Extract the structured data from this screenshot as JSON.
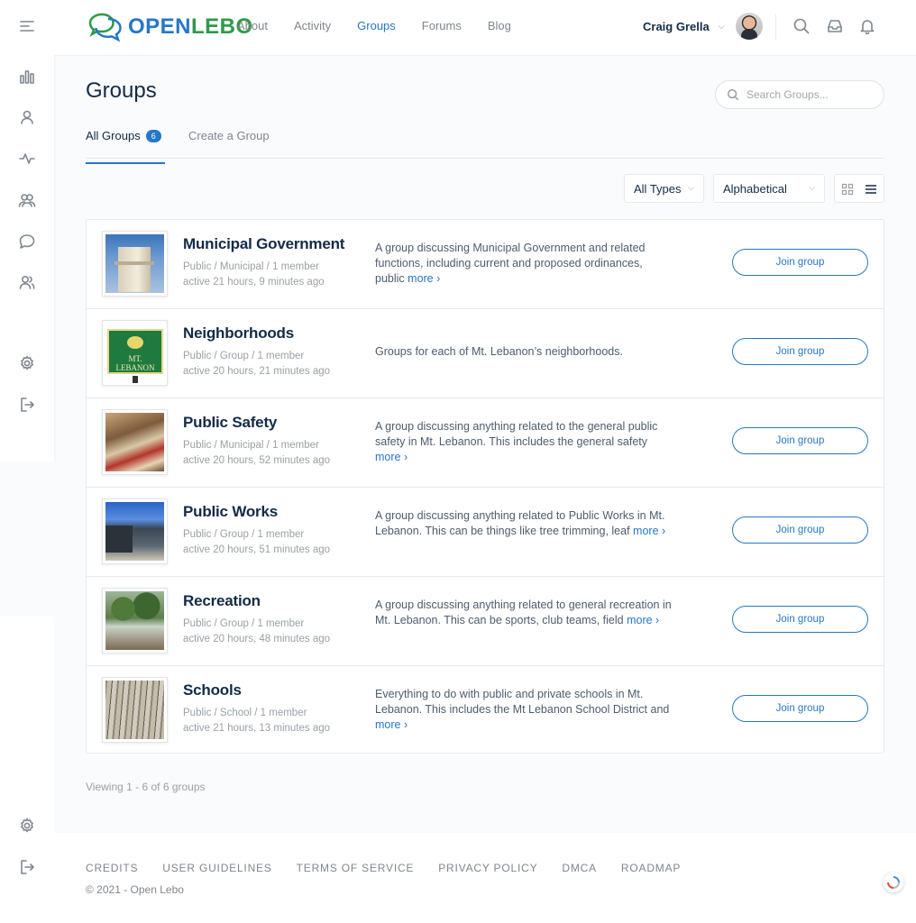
{
  "brand": {
    "open": "OPEN",
    "lebo": "LEBO"
  },
  "nav": [
    "About",
    "Activity",
    "Groups",
    "Forums",
    "Blog"
  ],
  "user": {
    "name": "Craig Grella"
  },
  "page": {
    "title": "Groups"
  },
  "search": {
    "placeholder": "Search Groups..."
  },
  "tabs": {
    "all_label": "All Groups",
    "all_count": "6",
    "create_label": "Create a Group"
  },
  "filters": {
    "type": "All Types",
    "order": "Alphabetical"
  },
  "groups": [
    {
      "name": "Municipal Government",
      "type": "Public / Municipal / 1 member",
      "active": "active 21 hours, 9 minutes ago",
      "desc": "A group discussing Municipal Government and related functions, including current and proposed ordinances, public",
      "more": "more ›",
      "join": "Join group"
    },
    {
      "name": "Neighborhoods",
      "type": "Public / Group / 1 member",
      "active": "active 20 hours, 21 minutes ago",
      "desc": "Groups for each of Mt. Lebanon’s neighborhoods.",
      "more": "",
      "join": "Join group"
    },
    {
      "name": "Public Safety",
      "type": "Public / Municipal / 1 member",
      "active": "active 20 hours, 52 minutes ago",
      "desc": "A group discussing anything related to the general public safety in Mt. Lebanon. This includes the general safety",
      "more": "more ›",
      "join": "Join group"
    },
    {
      "name": "Public Works",
      "type": "Public / Group / 1 member",
      "active": "active 20 hours, 51 minutes ago",
      "desc": "A group discussing anything related to Public Works in Mt. Lebanon. This can be things like tree trimming, leaf",
      "more": "more ›",
      "join": "Join group"
    },
    {
      "name": "Recreation",
      "type": "Public / Group / 1 member",
      "active": "active 20 hours, 48 minutes ago",
      "desc": "A group discussing anything related to general recreation in Mt. Lebanon. This can be sports, club teams, field",
      "more": "more ›",
      "join": "Join group"
    },
    {
      "name": "Schools",
      "type": "Public / School / 1 member",
      "active": "active 21 hours, 13 minutes ago",
      "desc": "Everything to do with public and private schools in Mt. Lebanon. This includes the Mt Lebanon School District and",
      "more": "more ›",
      "join": "Join group"
    }
  ],
  "neighborhood_sign_text": "MT. LEBANON",
  "viewing": "Viewing 1 - 6 of 6 groups",
  "footer": {
    "links": [
      "CREDITS",
      "USER GUIDELINES",
      "TERMS OF SERVICE",
      "PRIVACY POLICY",
      "DMCA",
      "ROADMAP"
    ],
    "copyright": "© 2021 - Open Lebo"
  },
  "colors": {
    "accent": "#2577c8",
    "brand_green": "#2e9a4a",
    "text_dark": "#122b46",
    "muted": "#7f868f"
  }
}
